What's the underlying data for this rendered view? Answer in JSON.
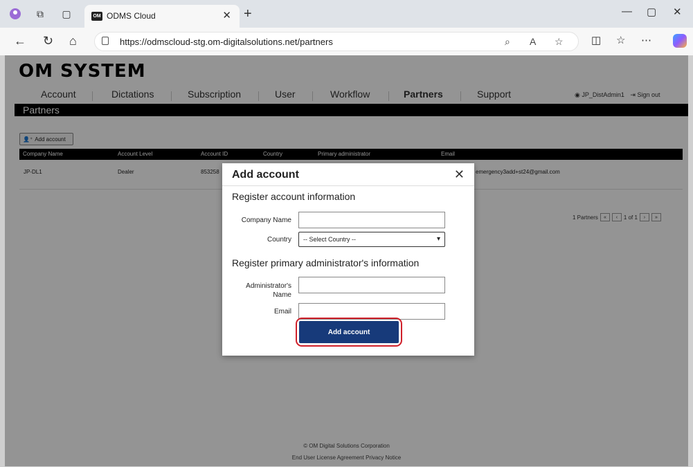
{
  "browser": {
    "tab_title": "ODMS Cloud",
    "tab_favicon": "OM",
    "url": "https://odmscloud-stg.om-digitalsolutions.net/partners"
  },
  "app": {
    "logo": "OM SYSTEM",
    "nav": [
      "Account",
      "Dictations",
      "Subscription",
      "User",
      "Workflow",
      "Partners",
      "Support"
    ],
    "active_nav": "Partners",
    "user_name": "JP_DistAdmin1",
    "sign_out": "Sign out",
    "page_title": "Partners"
  },
  "partners": {
    "add_account_label": "Add account",
    "columns": [
      "Company Name",
      "Account Level",
      "Account ID",
      "Country",
      "Primary administrator",
      "Email"
    ],
    "rows": [
      {
        "company": "JP-DL1",
        "level": "Dealer",
        "id": "853258",
        "email": "emergency3add+st24@gmail.com"
      }
    ],
    "pager_text": "1 Partners",
    "pager_page": "1 of 1"
  },
  "footer": {
    "copyright": "© OM Digital Solutions Corporation",
    "links": "End User License Agreement   Privacy Notice"
  },
  "modal": {
    "title": "Add account",
    "section1": "Register account information",
    "company_label": "Company Name",
    "country_label": "Country",
    "country_value": "-- Select Country --",
    "section2": "Register primary administrator's information",
    "admin_label": "Administrator's Name",
    "email_label": "Email",
    "submit_label": "Add account",
    "highlight_color": "#d0202a",
    "submit_color": "#173a7a"
  }
}
